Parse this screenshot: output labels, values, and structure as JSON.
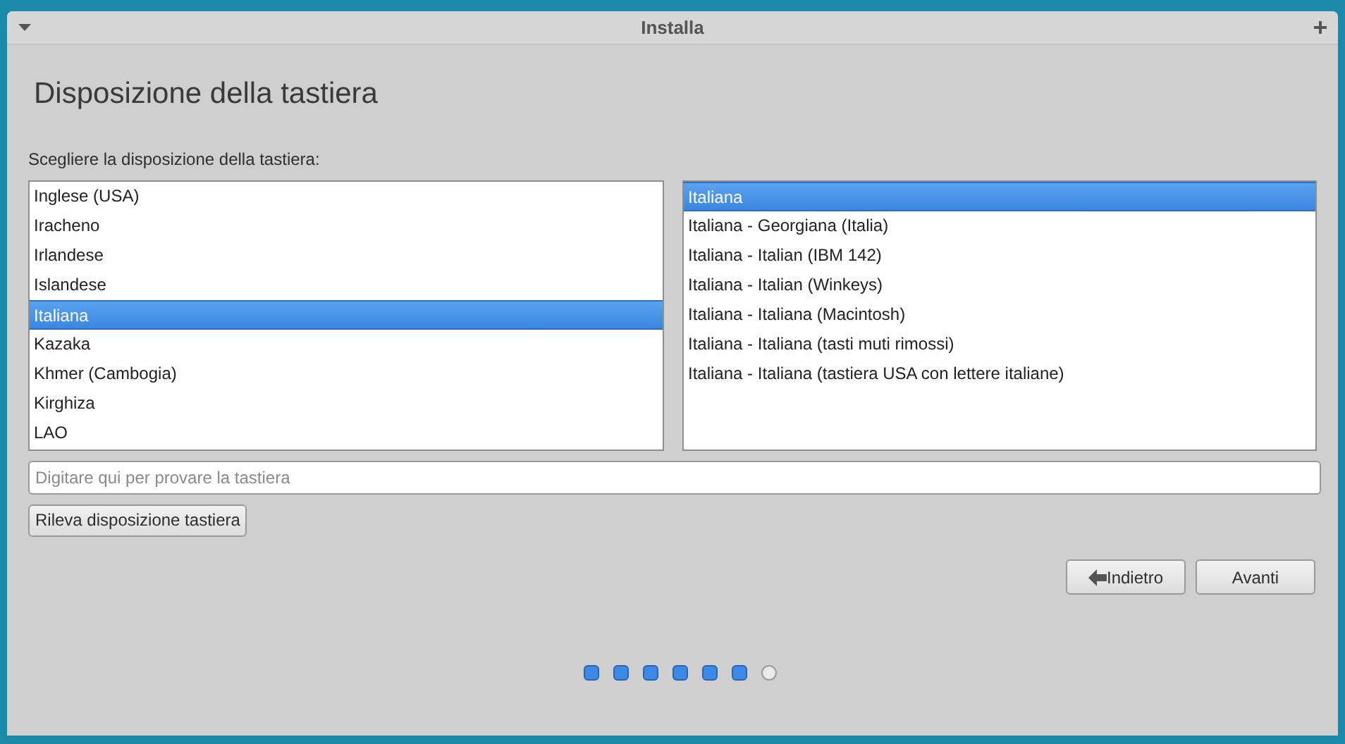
{
  "window": {
    "title": "Installa"
  },
  "heading": "Disposizione della tastiera",
  "prompt": "Scegliere la disposizione della tastiera:",
  "layouts": [
    {
      "label": "Inglese (USA)",
      "selected": false
    },
    {
      "label": "Iracheno",
      "selected": false
    },
    {
      "label": "Irlandese",
      "selected": false
    },
    {
      "label": "Islandese",
      "selected": false
    },
    {
      "label": "Italiana",
      "selected": true
    },
    {
      "label": "Kazaka",
      "selected": false
    },
    {
      "label": "Khmer (Cambogia)",
      "selected": false
    },
    {
      "label": "Kirghiza",
      "selected": false
    },
    {
      "label": "LAO",
      "selected": false
    }
  ],
  "variants": [
    {
      "label": "Italiana",
      "selected": true
    },
    {
      "label": "Italiana - Georgiana (Italia)",
      "selected": false
    },
    {
      "label": "Italiana - Italian (IBM 142)",
      "selected": false
    },
    {
      "label": "Italiana - Italian (Winkeys)",
      "selected": false
    },
    {
      "label": "Italiana - Italiana (Macintosh)",
      "selected": false
    },
    {
      "label": "Italiana - Italiana (tasti muti rimossi)",
      "selected": false
    },
    {
      "label": "Italiana - Italiana (tastiera USA con lettere italiane)",
      "selected": false
    }
  ],
  "test_field": {
    "placeholder": "Digitare qui per provare la tastiera"
  },
  "detect_button": "Rileva disposizione tastiera",
  "buttons": [
    {
      "label": "Indietro",
      "kind": "back"
    },
    {
      "label": "Avanti",
      "kind": "next"
    }
  ],
  "progress": [
    {
      "done": true
    },
    {
      "done": true
    },
    {
      "done": true
    },
    {
      "done": true
    },
    {
      "done": true
    },
    {
      "done": true
    },
    {
      "done": false
    }
  ]
}
